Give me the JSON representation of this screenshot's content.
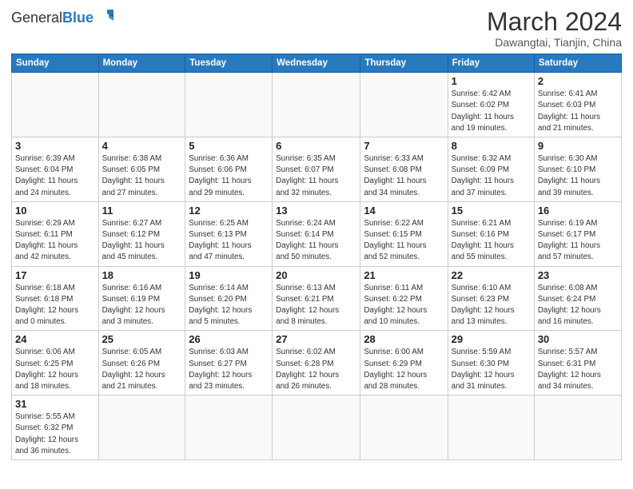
{
  "logo": {
    "text_general": "General",
    "text_blue": "Blue"
  },
  "header": {
    "month_year": "March 2024",
    "location": "Dawangtai, Tianjin, China"
  },
  "weekdays": [
    "Sunday",
    "Monday",
    "Tuesday",
    "Wednesday",
    "Thursday",
    "Friday",
    "Saturday"
  ],
  "weeks": [
    [
      {
        "day": "",
        "info": ""
      },
      {
        "day": "",
        "info": ""
      },
      {
        "day": "",
        "info": ""
      },
      {
        "day": "",
        "info": ""
      },
      {
        "day": "",
        "info": ""
      },
      {
        "day": "1",
        "info": "Sunrise: 6:42 AM\nSunset: 6:02 PM\nDaylight: 11 hours\nand 19 minutes."
      },
      {
        "day": "2",
        "info": "Sunrise: 6:41 AM\nSunset: 6:03 PM\nDaylight: 11 hours\nand 21 minutes."
      }
    ],
    [
      {
        "day": "3",
        "info": "Sunrise: 6:39 AM\nSunset: 6:04 PM\nDaylight: 11 hours\nand 24 minutes."
      },
      {
        "day": "4",
        "info": "Sunrise: 6:38 AM\nSunset: 6:05 PM\nDaylight: 11 hours\nand 27 minutes."
      },
      {
        "day": "5",
        "info": "Sunrise: 6:36 AM\nSunset: 6:06 PM\nDaylight: 11 hours\nand 29 minutes."
      },
      {
        "day": "6",
        "info": "Sunrise: 6:35 AM\nSunset: 6:07 PM\nDaylight: 11 hours\nand 32 minutes."
      },
      {
        "day": "7",
        "info": "Sunrise: 6:33 AM\nSunset: 6:08 PM\nDaylight: 11 hours\nand 34 minutes."
      },
      {
        "day": "8",
        "info": "Sunrise: 6:32 AM\nSunset: 6:09 PM\nDaylight: 11 hours\nand 37 minutes."
      },
      {
        "day": "9",
        "info": "Sunrise: 6:30 AM\nSunset: 6:10 PM\nDaylight: 11 hours\nand 39 minutes."
      }
    ],
    [
      {
        "day": "10",
        "info": "Sunrise: 6:29 AM\nSunset: 6:11 PM\nDaylight: 11 hours\nand 42 minutes."
      },
      {
        "day": "11",
        "info": "Sunrise: 6:27 AM\nSunset: 6:12 PM\nDaylight: 11 hours\nand 45 minutes."
      },
      {
        "day": "12",
        "info": "Sunrise: 6:25 AM\nSunset: 6:13 PM\nDaylight: 11 hours\nand 47 minutes."
      },
      {
        "day": "13",
        "info": "Sunrise: 6:24 AM\nSunset: 6:14 PM\nDaylight: 11 hours\nand 50 minutes."
      },
      {
        "day": "14",
        "info": "Sunrise: 6:22 AM\nSunset: 6:15 PM\nDaylight: 11 hours\nand 52 minutes."
      },
      {
        "day": "15",
        "info": "Sunrise: 6:21 AM\nSunset: 6:16 PM\nDaylight: 11 hours\nand 55 minutes."
      },
      {
        "day": "16",
        "info": "Sunrise: 6:19 AM\nSunset: 6:17 PM\nDaylight: 11 hours\nand 57 minutes."
      }
    ],
    [
      {
        "day": "17",
        "info": "Sunrise: 6:18 AM\nSunset: 6:18 PM\nDaylight: 12 hours\nand 0 minutes."
      },
      {
        "day": "18",
        "info": "Sunrise: 6:16 AM\nSunset: 6:19 PM\nDaylight: 12 hours\nand 3 minutes."
      },
      {
        "day": "19",
        "info": "Sunrise: 6:14 AM\nSunset: 6:20 PM\nDaylight: 12 hours\nand 5 minutes."
      },
      {
        "day": "20",
        "info": "Sunrise: 6:13 AM\nSunset: 6:21 PM\nDaylight: 12 hours\nand 8 minutes."
      },
      {
        "day": "21",
        "info": "Sunrise: 6:11 AM\nSunset: 6:22 PM\nDaylight: 12 hours\nand 10 minutes."
      },
      {
        "day": "22",
        "info": "Sunrise: 6:10 AM\nSunset: 6:23 PM\nDaylight: 12 hours\nand 13 minutes."
      },
      {
        "day": "23",
        "info": "Sunrise: 6:08 AM\nSunset: 6:24 PM\nDaylight: 12 hours\nand 16 minutes."
      }
    ],
    [
      {
        "day": "24",
        "info": "Sunrise: 6:06 AM\nSunset: 6:25 PM\nDaylight: 12 hours\nand 18 minutes."
      },
      {
        "day": "25",
        "info": "Sunrise: 6:05 AM\nSunset: 6:26 PM\nDaylight: 12 hours\nand 21 minutes."
      },
      {
        "day": "26",
        "info": "Sunrise: 6:03 AM\nSunset: 6:27 PM\nDaylight: 12 hours\nand 23 minutes."
      },
      {
        "day": "27",
        "info": "Sunrise: 6:02 AM\nSunset: 6:28 PM\nDaylight: 12 hours\nand 26 minutes."
      },
      {
        "day": "28",
        "info": "Sunrise: 6:00 AM\nSunset: 6:29 PM\nDaylight: 12 hours\nand 28 minutes."
      },
      {
        "day": "29",
        "info": "Sunrise: 5:59 AM\nSunset: 6:30 PM\nDaylight: 12 hours\nand 31 minutes."
      },
      {
        "day": "30",
        "info": "Sunrise: 5:57 AM\nSunset: 6:31 PM\nDaylight: 12 hours\nand 34 minutes."
      }
    ],
    [
      {
        "day": "31",
        "info": "Sunrise: 5:55 AM\nSunset: 6:32 PM\nDaylight: 12 hours\nand 36 minutes."
      },
      {
        "day": "",
        "info": ""
      },
      {
        "day": "",
        "info": ""
      },
      {
        "day": "",
        "info": ""
      },
      {
        "day": "",
        "info": ""
      },
      {
        "day": "",
        "info": ""
      },
      {
        "day": "",
        "info": ""
      }
    ]
  ]
}
